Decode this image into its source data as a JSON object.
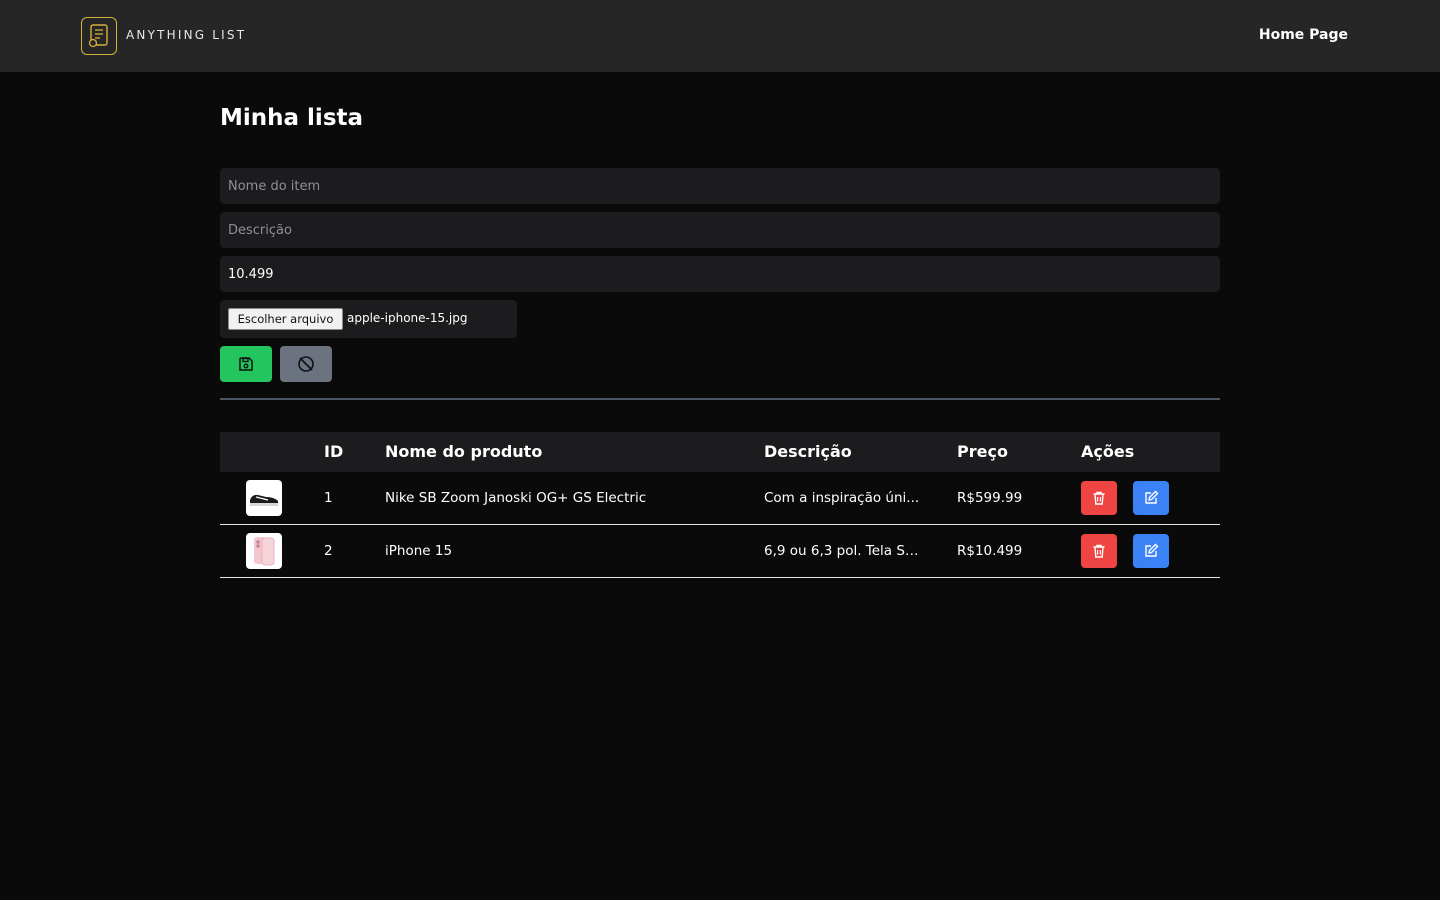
{
  "app": {
    "brand": "ANYTHING LIST",
    "nav_home": "Home Page"
  },
  "page": {
    "title": "Minha lista"
  },
  "form": {
    "name_placeholder": "Nome do item",
    "name_value": "",
    "description_placeholder": "Descrição",
    "description_value": "",
    "price_value": "10.499",
    "file_button_label": "Escolher arquivo",
    "file_name": "apple-iphone-15.jpg"
  },
  "colors": {
    "save": "#22c55e",
    "cancel": "#6b7280",
    "delete": "#ef4444",
    "edit": "#3b82f6",
    "logo": "#d4b13a"
  },
  "table": {
    "headers": {
      "id": "ID",
      "name": "Nome do produto",
      "description": "Descrição",
      "price": "Preço",
      "actions": "Ações"
    },
    "rows": [
      {
        "thumb_icon": "sneaker-image",
        "id": "1",
        "name": "Nike SB Zoom Janoski OG+ GS Electric",
        "description": "Com a inspiração úni...",
        "price": "R$599.99"
      },
      {
        "thumb_icon": "iphone-image",
        "id": "2",
        "name": "iPhone 15",
        "description": "6,9 ou 6,3 pol. Tela Su...",
        "price": "R$10.499"
      }
    ]
  }
}
